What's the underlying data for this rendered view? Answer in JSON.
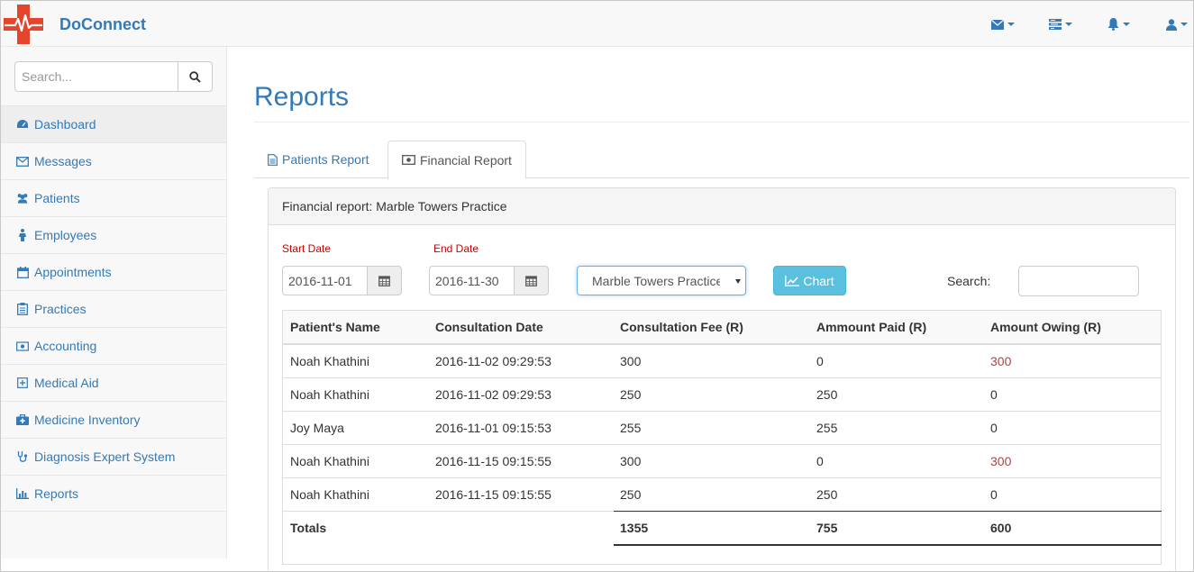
{
  "app": {
    "brand": "DoConnect"
  },
  "navbar": {
    "items": [
      {
        "icon": "envelope-icon"
      },
      {
        "icon": "tasks-icon"
      },
      {
        "icon": "bell-icon"
      },
      {
        "icon": "user-icon"
      }
    ]
  },
  "sidebar": {
    "search_placeholder": "Search...",
    "items": [
      {
        "label": "Dashboard",
        "icon": "dashboard-icon"
      },
      {
        "label": "Messages",
        "icon": "envelope-icon"
      },
      {
        "label": "Patients",
        "icon": "users-icon"
      },
      {
        "label": "Employees",
        "icon": "person-icon"
      },
      {
        "label": "Appointments",
        "icon": "calendar-icon"
      },
      {
        "label": "Practices",
        "icon": "clipboard-icon"
      },
      {
        "label": "Accounting",
        "icon": "money-icon"
      },
      {
        "label": "Medical Aid",
        "icon": "plus-square-icon"
      },
      {
        "label": "Medicine Inventory",
        "icon": "medkit-icon"
      },
      {
        "label": "Diagnosis Expert System",
        "icon": "stethoscope-icon"
      },
      {
        "label": "Reports",
        "icon": "bar-chart-icon"
      }
    ]
  },
  "main": {
    "title": "Reports",
    "tabs": [
      {
        "label": "Patients Report",
        "icon": "file-text-icon"
      },
      {
        "label": "Financial Report",
        "icon": "money-icon",
        "active": true
      }
    ],
    "panel": {
      "heading": "Financial report: Marble Towers Practice",
      "start_date_label": "Start Date",
      "start_date": "2016-11-01",
      "end_date_label": "End Date",
      "end_date": "2016-11-30",
      "practice_select": "Marble Towers Practice",
      "chart_button": "Chart",
      "search_label": "Search:",
      "table": {
        "headers": [
          "Patient's Name",
          "Consultation Date",
          "Consultation Fee (R)",
          "Ammount Paid (R)",
          "Amount Owing (R)"
        ],
        "rows": [
          [
            "Noah Khathini",
            "2016-11-02 09:29:53",
            "300",
            "0",
            "300"
          ],
          [
            "Noah Khathini",
            "2016-11-02 09:29:53",
            "250",
            "250",
            "0"
          ],
          [
            "Joy Maya",
            "2016-11-01 09:15:53",
            "255",
            "255",
            "0"
          ],
          [
            "Noah Khathini",
            "2016-11-15 09:15:55",
            "300",
            "0",
            "300"
          ],
          [
            "Noah Khathini",
            "2016-11-15 09:15:55",
            "250",
            "250",
            "0"
          ]
        ],
        "totals": [
          "Totals",
          "",
          "1355",
          "755",
          "600"
        ]
      }
    }
  },
  "colors": {
    "link": "#337ab7",
    "owing": "#a94442",
    "info_button": "#5bc0de",
    "logo_red": "#e4452b"
  }
}
